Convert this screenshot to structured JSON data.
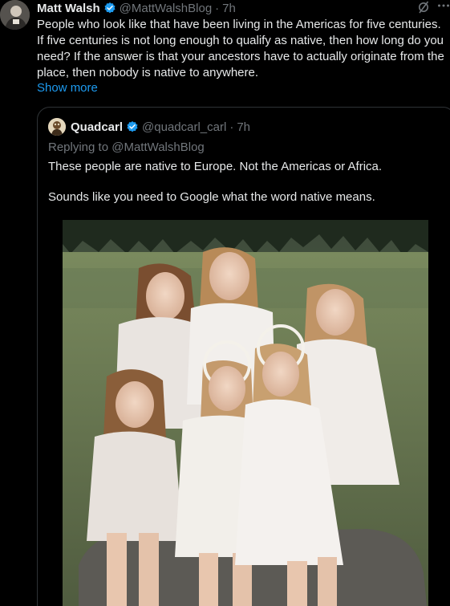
{
  "main_tweet": {
    "display_name": "Matt Walsh",
    "handle": "@MattWalshBlog",
    "separator": "·",
    "time": "7h",
    "text": "People who look like that have been living in the Americas for five centuries. If five centuries is not long enough to qualify as native, then how long do you need? If the answer is that your ancestors have to actually originate from the place, then nobody is native to anywhere.",
    "show_more": "Show more"
  },
  "quoted_tweet": {
    "display_name": "Quadcarl",
    "handle": "@quadcarl_carl",
    "separator": "·",
    "time": "7h",
    "replying_to_prefix": "Replying to ",
    "replying_to_handle": "@MattWalshBlog",
    "paragraph_1": "These people are native to Europe. Not the Americas or Africa.",
    "paragraph_2": "Sounds like you need to Google what the word native means.",
    "photo": {
      "content": "group-of-seven-girls-in-white-dresses-on-rock-in-field"
    }
  },
  "colors": {
    "background": "#000000",
    "text": "#e7e9ea",
    "muted": "#71767b",
    "link": "#1d9bf0",
    "verified": "#1d9bf0",
    "border": "#2f3336"
  },
  "icons": {
    "verified": "verified-badge-icon",
    "grok": "grok-icon",
    "more": "more-horizontal-icon"
  }
}
